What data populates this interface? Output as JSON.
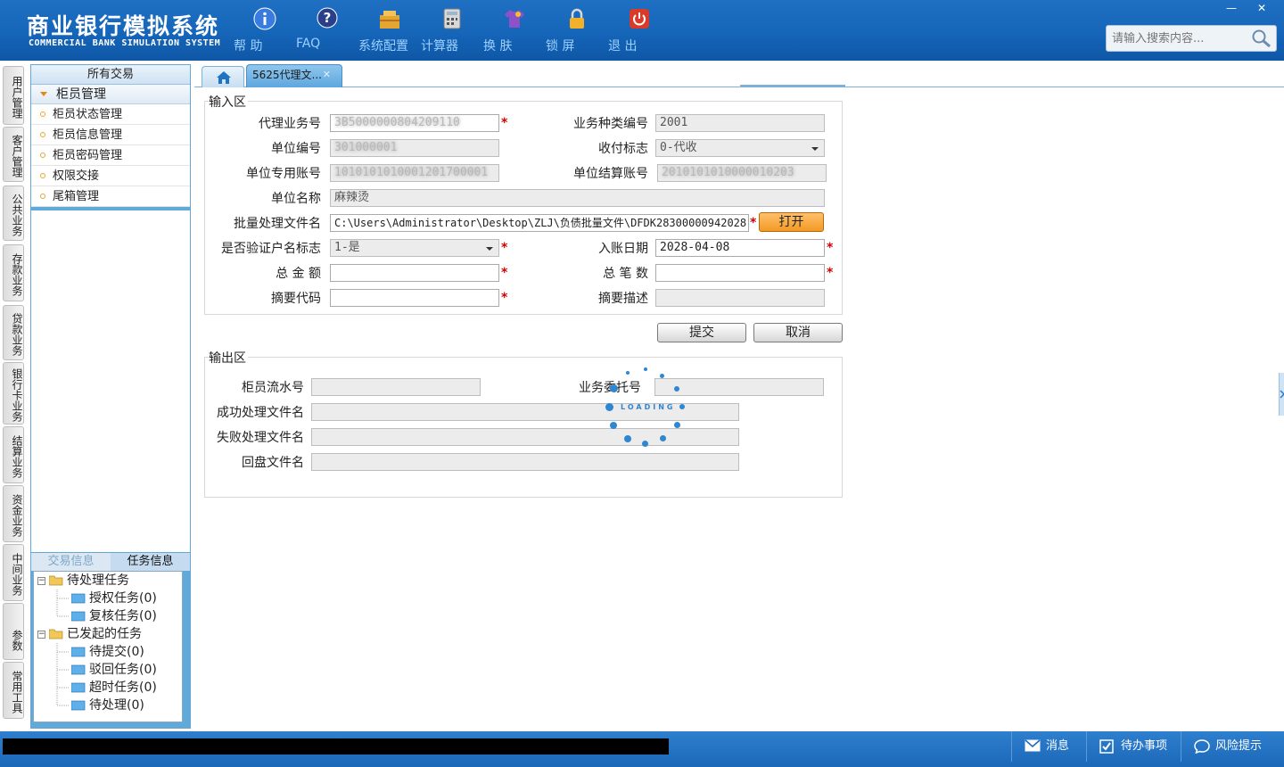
{
  "app": {
    "title_cn": "商业银行模拟系统",
    "title_en": "COMMERCIAL BANK SIMULATION SYSTEM",
    "accent_color": "#1565b9"
  },
  "toolbar": [
    {
      "label": "帮 助",
      "icon": "info-icon"
    },
    {
      "label": "FAQ",
      "icon": "question-icon"
    },
    {
      "label": "系统配置",
      "icon": "config-icon"
    },
    {
      "label": "计算器",
      "icon": "calculator-icon"
    },
    {
      "label": "换 肤",
      "icon": "shirt-icon"
    },
    {
      "label": "锁 屏",
      "icon": "lock-icon"
    },
    {
      "label": "退 出",
      "icon": "power-icon"
    }
  ],
  "window_controls": {
    "minimize": "—",
    "close": "✕"
  },
  "search": {
    "placeholder": "请输入搜索内容..."
  },
  "vertical_tabs": [
    "用户管理",
    "客户管理",
    "公共业务",
    "存款业务",
    "贷款业务",
    "银行卡业务",
    "结算业务",
    "资金业务",
    "中间业务",
    "参数",
    "常用工具"
  ],
  "sidebar": {
    "header": "所有交易",
    "group": "柜员管理",
    "items": [
      "柜员状态管理",
      "柜员信息管理",
      "柜员密码管理",
      "权限交接",
      "尾箱管理"
    ],
    "bottom_tabs": {
      "info": "交易信息",
      "tasks": "任务信息"
    },
    "tree": {
      "pending": "待处理任务",
      "auth": "授权任务(0)",
      "review": "复核任务(0)",
      "initiated": "已发起的任务",
      "to_submit": "待提交(0)",
      "rejected": "驳回任务(0)",
      "timeout": "超时任务(0)",
      "to_process": "待处理(0)"
    }
  },
  "tabs": {
    "doc": "5625代理文...",
    "close": "✕"
  },
  "input_section": {
    "title": "输入区",
    "agent_business_no": {
      "label": "代理业务号",
      "value": "3B5000000804209110"
    },
    "business_type_no": {
      "label": "业务种类编号",
      "value": "2001"
    },
    "unit_no": {
      "label": "单位编号",
      "value": "301000001"
    },
    "payment_flag": {
      "label": "收付标志",
      "value": "0-代收"
    },
    "unit_account": {
      "label": "单位专用账号",
      "value": "1010101010001201700001"
    },
    "unit_settle_account": {
      "label": "单位结算账号",
      "value": "2010101010000010203"
    },
    "unit_name": {
      "label": "单位名称",
      "value": "麻辣烫"
    },
    "batch_file": {
      "label": "批量处理文件名",
      "value": "C:\\Users\\Administrator\\Desktop\\ZLJ\\负债批量文件\\DFDK28300000942028"
    },
    "open_button": "打开",
    "verify_name": {
      "label": "是否验证户名标志",
      "value": "1-是"
    },
    "entry_date": {
      "label": "入账日期",
      "value": "2028-04-08"
    },
    "total_amount": {
      "label": "总 金 额",
      "value": ""
    },
    "total_count": {
      "label": "总 笔 数",
      "value": ""
    },
    "summary_code": {
      "label": "摘要代码",
      "value": ""
    },
    "summary_desc": {
      "label": "摘要描述",
      "value": ""
    },
    "required_mark": "*"
  },
  "actions": {
    "submit": "提交",
    "cancel": "取消"
  },
  "output_section": {
    "title": "输出区",
    "teller_serial": {
      "label": "柜员流水号",
      "value": ""
    },
    "business_entrust_no": {
      "label": "业务委托号",
      "value": ""
    },
    "success_file": {
      "label": "成功处理文件名",
      "value": ""
    },
    "failure_file": {
      "label": "失败处理文件名",
      "value": ""
    },
    "return_file": {
      "label": "回盘文件名",
      "value": ""
    }
  },
  "loading": {
    "text": "LOADING"
  },
  "statusbar": {
    "message": "消息",
    "todo": "待办事项",
    "risk": "风险提示"
  }
}
